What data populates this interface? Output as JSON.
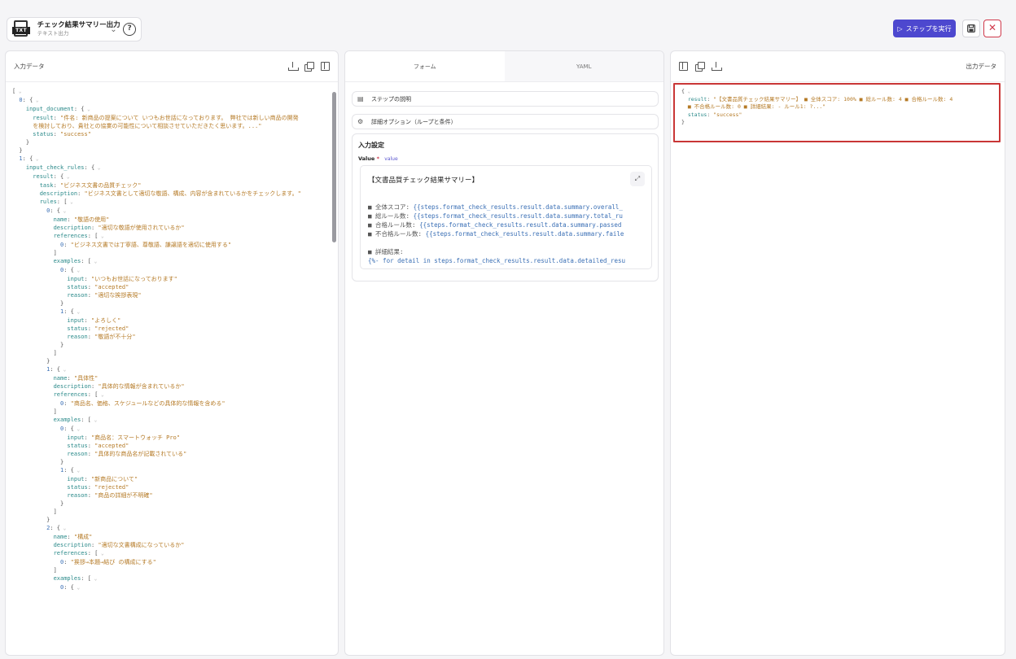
{
  "header": {
    "step_title": "チェック結果サマリー出力",
    "step_subtitle": "テキスト出力",
    "run_label": "ステップを実行"
  },
  "input_panel": {
    "title": "入力データ",
    "lines": [
      [
        [
          "p",
          "["
        ],
        [
          "cv",
          " ⌄"
        ]
      ],
      [
        [
          "n",
          "  0"
        ],
        [
          "p",
          ": {"
        ],
        [
          "cv",
          " ⌄"
        ]
      ],
      [
        [
          "k",
          "    input_document"
        ],
        [
          "p",
          ": {"
        ],
        [
          "cv",
          " ⌄"
        ]
      ],
      [
        [
          "k",
          "      result"
        ],
        [
          "p",
          ": "
        ],
        [
          "s",
          "\"件名: 新商品の提案について いつもお世話になっております。 弊社では新しい商品の開発"
        ]
      ],
      [
        [
          "s",
          "      を検討しており、貴社との協業の可能性について相談させていただきたく思います。...\""
        ]
      ],
      [
        [
          "k",
          "      status"
        ],
        [
          "p",
          ": "
        ],
        [
          "s",
          "\"success\""
        ]
      ],
      [
        [
          "p",
          "    }"
        ]
      ],
      [
        [
          "p",
          "  }"
        ]
      ],
      [
        [
          "n",
          "  1"
        ],
        [
          "p",
          ": {"
        ],
        [
          "cv",
          " ⌄"
        ]
      ],
      [
        [
          "k",
          "    input_check_rules"
        ],
        [
          "p",
          ": {"
        ],
        [
          "cv",
          " ⌄"
        ]
      ],
      [
        [
          "k",
          "      result"
        ],
        [
          "p",
          ": {"
        ],
        [
          "cv",
          " ⌄"
        ]
      ],
      [
        [
          "k",
          "        task"
        ],
        [
          "p",
          ": "
        ],
        [
          "s",
          "\"ビジネス文書の品質チェック\""
        ]
      ],
      [
        [
          "k",
          "        description"
        ],
        [
          "p",
          ": "
        ],
        [
          "s",
          "\"ビジネス文書として適切な敬語、構成、内容が含まれているかをチェックします。\""
        ]
      ],
      [
        [
          "k",
          "        rules"
        ],
        [
          "p",
          ": ["
        ],
        [
          "cv",
          " ⌄"
        ]
      ],
      [
        [
          "n",
          "          0"
        ],
        [
          "p",
          ": {"
        ],
        [
          "cv",
          " ⌄"
        ]
      ],
      [
        [
          "k",
          "            name"
        ],
        [
          "p",
          ": "
        ],
        [
          "s",
          "\"敬語の使用\""
        ]
      ],
      [
        [
          "k",
          "            description"
        ],
        [
          "p",
          ": "
        ],
        [
          "s",
          "\"適切な敬語が使用されているか\""
        ]
      ],
      [
        [
          "k",
          "            references"
        ],
        [
          "p",
          ": ["
        ],
        [
          "cv",
          " ⌄"
        ]
      ],
      [
        [
          "n",
          "              0"
        ],
        [
          "p",
          ": "
        ],
        [
          "s",
          "\"ビジネス文書では丁寧語、尊敬語、謙譲語を適切に使用する\""
        ]
      ],
      [
        [
          "p",
          "            ]"
        ]
      ],
      [
        [
          "k",
          "            examples"
        ],
        [
          "p",
          ": ["
        ],
        [
          "cv",
          " ⌄"
        ]
      ],
      [
        [
          "n",
          "              0"
        ],
        [
          "p",
          ": {"
        ],
        [
          "cv",
          " ⌄"
        ]
      ],
      [
        [
          "k",
          "                input"
        ],
        [
          "p",
          ": "
        ],
        [
          "s",
          "\"いつもお世話になっております\""
        ]
      ],
      [
        [
          "k",
          "                status"
        ],
        [
          "p",
          ": "
        ],
        [
          "s",
          "\"accepted\""
        ]
      ],
      [
        [
          "k",
          "                reason"
        ],
        [
          "p",
          ": "
        ],
        [
          "s",
          "\"適切な挨拶表現\""
        ]
      ],
      [
        [
          "p",
          "              }"
        ]
      ],
      [
        [
          "n",
          "              1"
        ],
        [
          "p",
          ": {"
        ],
        [
          "cv",
          " ⌄"
        ]
      ],
      [
        [
          "k",
          "                input"
        ],
        [
          "p",
          ": "
        ],
        [
          "s",
          "\"よろしく\""
        ]
      ],
      [
        [
          "k",
          "                status"
        ],
        [
          "p",
          ": "
        ],
        [
          "s",
          "\"rejected\""
        ]
      ],
      [
        [
          "k",
          "                reason"
        ],
        [
          "p",
          ": "
        ],
        [
          "s",
          "\"敬語が不十分\""
        ]
      ],
      [
        [
          "p",
          "              }"
        ]
      ],
      [
        [
          "p",
          "            ]"
        ]
      ],
      [
        [
          "p",
          "          }"
        ]
      ],
      [
        [
          "n",
          "          1"
        ],
        [
          "p",
          ": {"
        ],
        [
          "cv",
          " ⌄"
        ]
      ],
      [
        [
          "k",
          "            name"
        ],
        [
          "p",
          ": "
        ],
        [
          "s",
          "\"具体性\""
        ]
      ],
      [
        [
          "k",
          "            description"
        ],
        [
          "p",
          ": "
        ],
        [
          "s",
          "\"具体的な情報が含まれているか\""
        ]
      ],
      [
        [
          "k",
          "            references"
        ],
        [
          "p",
          ": ["
        ],
        [
          "cv",
          " ⌄"
        ]
      ],
      [
        [
          "n",
          "              0"
        ],
        [
          "p",
          ": "
        ],
        [
          "s",
          "\"商品名、価格、スケジュールなどの具体的な情報を含める\""
        ]
      ],
      [
        [
          "p",
          "            ]"
        ]
      ],
      [
        [
          "k",
          "            examples"
        ],
        [
          "p",
          ": ["
        ],
        [
          "cv",
          " ⌄"
        ]
      ],
      [
        [
          "n",
          "              0"
        ],
        [
          "p",
          ": {"
        ],
        [
          "cv",
          " ⌄"
        ]
      ],
      [
        [
          "k",
          "                input"
        ],
        [
          "p",
          ": "
        ],
        [
          "s",
          "\"商品名：スマートウォッチ Pro\""
        ]
      ],
      [
        [
          "k",
          "                status"
        ],
        [
          "p",
          ": "
        ],
        [
          "s",
          "\"accepted\""
        ]
      ],
      [
        [
          "k",
          "                reason"
        ],
        [
          "p",
          ": "
        ],
        [
          "s",
          "\"具体的な商品名が記載されている\""
        ]
      ],
      [
        [
          "p",
          "              }"
        ]
      ],
      [
        [
          "n",
          "              1"
        ],
        [
          "p",
          ": {"
        ],
        [
          "cv",
          " ⌄"
        ]
      ],
      [
        [
          "k",
          "                input"
        ],
        [
          "p",
          ": "
        ],
        [
          "s",
          "\"新商品について\""
        ]
      ],
      [
        [
          "k",
          "                status"
        ],
        [
          "p",
          ": "
        ],
        [
          "s",
          "\"rejected\""
        ]
      ],
      [
        [
          "k",
          "                reason"
        ],
        [
          "p",
          ": "
        ],
        [
          "s",
          "\"商品の詳細が不明確\""
        ]
      ],
      [
        [
          "p",
          "              }"
        ]
      ],
      [
        [
          "p",
          "            ]"
        ]
      ],
      [
        [
          "p",
          "          }"
        ]
      ],
      [
        [
          "n",
          "          2"
        ],
        [
          "p",
          ": {"
        ],
        [
          "cv",
          " ⌄"
        ]
      ],
      [
        [
          "k",
          "            name"
        ],
        [
          "p",
          ": "
        ],
        [
          "s",
          "\"構成\""
        ]
      ],
      [
        [
          "k",
          "            description"
        ],
        [
          "p",
          ": "
        ],
        [
          "s",
          "\"適切な文書構成になっているか\""
        ]
      ],
      [
        [
          "k",
          "            references"
        ],
        [
          "p",
          ": ["
        ],
        [
          "cv",
          " ⌄"
        ]
      ],
      [
        [
          "n",
          "              0"
        ],
        [
          "p",
          ": "
        ],
        [
          "s",
          "\"挨拶→本題→結び の構成にする\""
        ]
      ],
      [
        [
          "p",
          "            ]"
        ]
      ],
      [
        [
          "k",
          "            examples"
        ],
        [
          "p",
          ": ["
        ],
        [
          "cv",
          " ⌄"
        ]
      ],
      [
        [
          "n",
          "              0"
        ],
        [
          "p",
          ": {"
        ],
        [
          "cv",
          " ⌄"
        ]
      ]
    ]
  },
  "middle_panel": {
    "tab_form": "フォーム",
    "tab_yaml": "YAML",
    "step_description": "ステップの説明",
    "advanced_options": "詳細オプション（ループと条件）",
    "settings_title": "入力設定",
    "value_label": "Value",
    "value_required": "*",
    "value_chip": "value",
    "editor_title": "【文書品質チェック結果サマリー】",
    "editor_lines": [
      [
        [
          "p",
          ""
        ]
      ],
      [
        [
          "p",
          "■ 全体スコア: "
        ],
        [
          "t",
          "{{steps.format_check_results.result.data.summary.overall_"
        ]
      ],
      [
        [
          "p",
          "■ 総ルール数: "
        ],
        [
          "t",
          "{{steps.format_check_results.result.data.summary.total_ru"
        ]
      ],
      [
        [
          "p",
          "■ 合格ルール数: "
        ],
        [
          "t",
          "{{steps.format_check_results.result.data.summary.passed"
        ]
      ],
      [
        [
          "p",
          "■ 不合格ルール数: "
        ],
        [
          "t",
          "{{steps.format_check_results.result.data.summary.faile"
        ]
      ],
      [
        [
          "p",
          ""
        ]
      ],
      [
        [
          "p",
          "■ 詳細結果:"
        ]
      ],
      [
        [
          "t",
          "{%- for detail in steps.format_check_results.result.data.detailed_resu"
        ]
      ]
    ]
  },
  "output_panel": {
    "title": "出力データ",
    "lines": [
      [
        [
          "p",
          "{"
        ],
        [
          "cv",
          " ⌄"
        ]
      ],
      [
        [
          "k",
          "  result"
        ],
        [
          "p",
          ": "
        ],
        [
          "s",
          "\"【文書品質チェック結果サマリー】 ■ 全体スコア: 100% ■ 総ルール数: 4 ■ 合格ルール数: 4"
        ]
      ],
      [
        [
          "s",
          "  ■ 不合格ルール数: 0 ■ 詳細結果: - ルール1: ?...\""
        ]
      ],
      [
        [
          "k",
          "  status"
        ],
        [
          "p",
          ": "
        ],
        [
          "s",
          "\"success\""
        ]
      ],
      [
        [
          "p",
          "}"
        ]
      ]
    ]
  }
}
